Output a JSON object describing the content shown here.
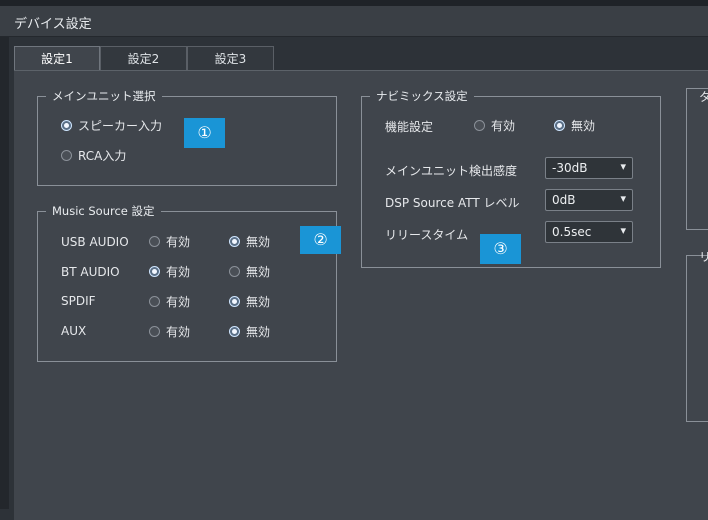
{
  "window": {
    "title": "デバイス設定"
  },
  "tabs": [
    {
      "label": "設定1",
      "active": true
    },
    {
      "label": "設定2",
      "active": false
    },
    {
      "label": "設定3",
      "active": false
    }
  ],
  "main_unit": {
    "legend": "メインユニット選択",
    "options": [
      {
        "label": "スピーカー入力",
        "selected": true
      },
      {
        "label": "RCA入力",
        "selected": false
      }
    ]
  },
  "music_source": {
    "legend": "Music Source 設定",
    "on_label": "有効",
    "off_label": "無効",
    "rows": [
      {
        "name": "USB AUDIO",
        "enabled": false
      },
      {
        "name": "BT AUDIO",
        "enabled": true
      },
      {
        "name": "SPDIF",
        "enabled": false
      },
      {
        "name": "AUX",
        "enabled": false
      }
    ]
  },
  "navimix": {
    "legend": "ナビミックス設定",
    "function_label": "機能設定",
    "on_label": "有効",
    "off_label": "無効",
    "enabled": false,
    "settings": [
      {
        "label": "メインユニット検出感度",
        "value": "-30dB"
      },
      {
        "label": "DSP Source ATT レベル",
        "value": "0dB"
      },
      {
        "label": "リリースタイム",
        "value": "0.5sec"
      }
    ]
  },
  "partial_right": {
    "top_char": "タ",
    "bottom_char": "リ"
  },
  "badges": [
    "①",
    "②",
    "③"
  ],
  "colors": {
    "badge": "#1a95d6",
    "background": "#40454c"
  }
}
